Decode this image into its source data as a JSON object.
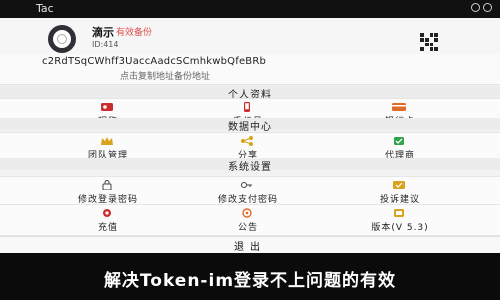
{
  "status_bar": {
    "carrier": "Tac"
  },
  "header": {
    "name": "滴示",
    "tag": "有效备份",
    "id": "ID:414"
  },
  "address": {
    "value": "c2RdTSqCWhff3UaccAadcSCmhkwbQfeBRb",
    "hint": "点击复制地址备份地址"
  },
  "sections": {
    "personal": "个人资料",
    "data": "数据中心",
    "settings": "系统设置"
  },
  "personal_items": [
    {
      "label": "昵称",
      "icon": "profile-icon",
      "color": "#cc2e2e"
    },
    {
      "label": "手机号",
      "icon": "phone-icon",
      "color": "#cc2e2e"
    },
    {
      "label": "银行卡",
      "icon": "bank-card-icon",
      "color": "#e06a2a"
    }
  ],
  "data_items": [
    {
      "label": "团队管理",
      "icon": "crown-icon",
      "color": "#d9a31e"
    },
    {
      "label": "分享",
      "icon": "share-icon",
      "color": "#d9a31e"
    },
    {
      "label": "代理商",
      "icon": "agent-icon",
      "color": "#2ea34a"
    }
  ],
  "settings_items_row1": [
    {
      "label": "修改登录密码",
      "icon": "lock-icon",
      "color": "#444444"
    },
    {
      "label": "修改支付密码",
      "icon": "key-icon",
      "color": "#444444"
    },
    {
      "label": "投诉建议",
      "icon": "feedback-icon",
      "color": "#d9a31e"
    }
  ],
  "settings_items_row2": [
    {
      "label": "充值",
      "icon": "recharge-icon",
      "color": "#cc2e2e"
    },
    {
      "label": "公告",
      "icon": "announcement-icon",
      "color": "#e06a2a"
    },
    {
      "label": "版本(V 5.3)",
      "icon": "version-icon",
      "color": "#d9a31e"
    }
  ],
  "logout": "退出",
  "bottom_text": "解决Token-im登录不上问题的有效"
}
